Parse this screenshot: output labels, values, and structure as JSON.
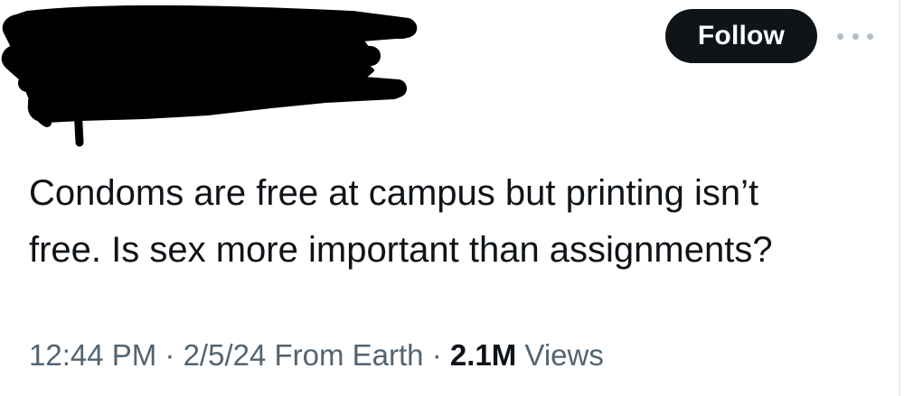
{
  "header": {
    "follow_label": "Follow",
    "more_icon": "more-dots-icon"
  },
  "tweet": {
    "text_line1": "Condoms are free at campus but printing isn’t",
    "text_line2": "free. Is sex more important than assignments?"
  },
  "meta": {
    "time": "12:44 PM",
    "separator1": " · ",
    "date": "2/5/24",
    "source": " From Earth",
    "separator2": " · ",
    "views_count": "2.1M",
    "views_label": " Views"
  },
  "colors": {
    "text": "#0f1419",
    "secondary_text": "#536471",
    "follow_bg": "#0f1419",
    "follow_text": "#ffffff",
    "redaction": "#000000"
  }
}
